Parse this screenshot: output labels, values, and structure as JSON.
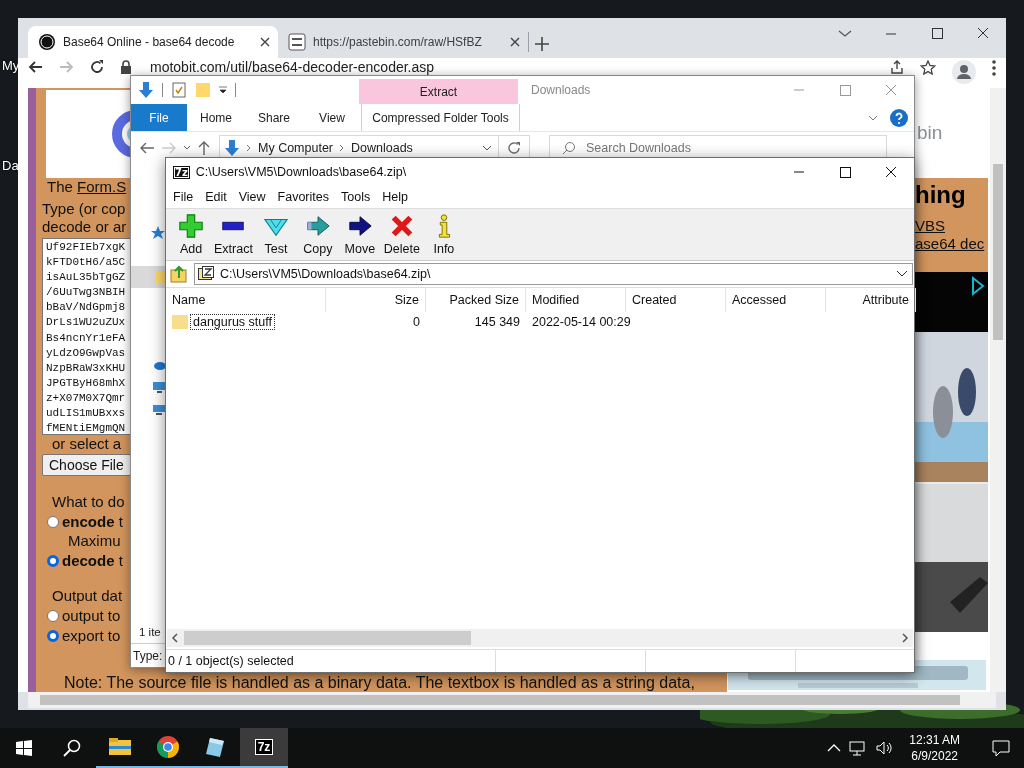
{
  "desktop": {
    "icon_labels": [
      "My",
      "Da"
    ]
  },
  "chrome": {
    "tabs": [
      {
        "title": "Base64 Online - base64 decode",
        "selected": true,
        "kind": "site"
      },
      {
        "title": "https://pastebin.com/raw/HSfBZ",
        "selected": false,
        "kind": "file"
      }
    ],
    "url": "motobit.com/util/base64-decoder-encoder.asp",
    "page": {
      "intro_prefix": "The",
      "intro_link": "Form.S",
      "prompt_lines": [
        "Type (or cop",
        "decode or ar"
      ],
      "textarea_lines": [
        "Uf92FIEb7xgK",
        "kFTD0tH6/a5C",
        "isAuL35bTgGZ",
        "/6UuTwg3NBIH",
        "bBaV/NdGpmj8",
        "DrLs1WU2uZUx",
        "Bs4ncnYr1eFA",
        "yLdzO9GwpVas",
        "NzpBRaW3xKHU",
        "JPGTByH68mhX",
        "z+X07M0X7Qmr",
        "udLIS1mUBxxs",
        "fMENtiEMgmQN"
      ],
      "file_prompt": "or select a",
      "choose_file": "Choose File",
      "action_prompt": "What to do",
      "actions": [
        {
          "label": "**encode** t",
          "selected": false,
          "note": "Maximu"
        },
        {
          "label": "**decode** t",
          "selected": true
        }
      ],
      "output_prompt": "Output dat",
      "outputs": [
        {
          "label": "output to",
          "selected": false
        },
        {
          "label": "export to",
          "selected": true
        }
      ],
      "note": "Note: The source file is handled as a binary data. The textbox is handled as a string data,",
      "side": {
        "logo_text": "bin",
        "heading": "hing",
        "links": [
          "VBS",
          "ase64 dec"
        ]
      }
    }
  },
  "explorer": {
    "context_tab": "Extract",
    "title": "Downloads",
    "ribbon_tabs": [
      {
        "label": "File",
        "kind": "file"
      },
      {
        "label": "Home",
        "kind": "tab"
      },
      {
        "label": "Share",
        "kind": "tab"
      },
      {
        "label": "View",
        "kind": "tab"
      },
      {
        "label": "Compressed Folder Tools",
        "kind": "context"
      }
    ],
    "breadcrumb": [
      "My Computer",
      "Downloads"
    ],
    "search_placeholder": "Search Downloads",
    "status": "1 ite",
    "details": "Type:"
  },
  "sevenzip": {
    "icon_text": "7z",
    "title": "C:\\Users\\VM5\\Downloads\\base64.zip\\",
    "menu": [
      "File",
      "Edit",
      "View",
      "Favorites",
      "Tools",
      "Help"
    ],
    "toolbar": [
      {
        "label": "Add",
        "kind": "add"
      },
      {
        "label": "Extract",
        "kind": "extract"
      },
      {
        "label": "Test",
        "kind": "test"
      },
      {
        "label": "Copy",
        "kind": "copy"
      },
      {
        "label": "Move",
        "kind": "move"
      },
      {
        "label": "Delete",
        "kind": "delete"
      },
      {
        "label": "Info",
        "kind": "info"
      }
    ],
    "address": "C:\\Users\\VM5\\Downloads\\base64.zip\\",
    "columns": [
      {
        "label": "Name",
        "right_aligned": false
      },
      {
        "label": "Size",
        "right_aligned": true
      },
      {
        "label": "Packed Size",
        "right_aligned": true
      },
      {
        "label": "Modified",
        "right_aligned": false
      },
      {
        "label": "Created",
        "right_aligned": false
      },
      {
        "label": "Accessed",
        "right_aligned": false
      },
      {
        "label": "Attribute",
        "right_aligned": true
      }
    ],
    "rows": [
      {
        "cells": [
          "dangurus stuff",
          "0",
          "145 349",
          "2022-05-14 00:29"
        ],
        "focused": true
      }
    ],
    "status": "0 / 1 object(s) selected"
  },
  "taskbar": {
    "apps": [
      {
        "kind": "explorer",
        "active": false
      },
      {
        "kind": "chrome",
        "active": false
      },
      {
        "kind": "notes",
        "active": false
      },
      {
        "kind": "sevenzip",
        "label": "7z",
        "active": true
      }
    ],
    "time": "12:31 AM",
    "date": "6/9/2022"
  }
}
